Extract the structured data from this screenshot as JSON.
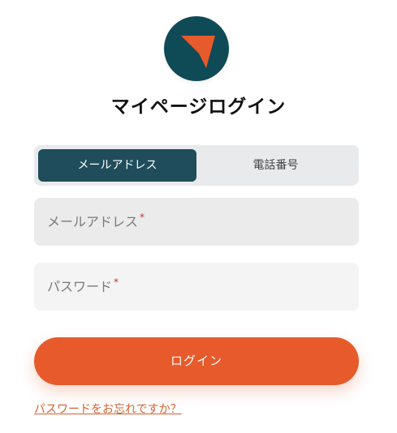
{
  "brand": {
    "logo_icon": "arrow-cursor-icon",
    "logo_bg_color": "#0f4a57",
    "logo_accent_color": "#e65a2b"
  },
  "page": {
    "title": "マイページログイン"
  },
  "tabs": {
    "items": [
      {
        "label": "メールアドレス",
        "active": true
      },
      {
        "label": "電話番号",
        "active": false
      }
    ]
  },
  "form": {
    "email_label": "メールアドレス",
    "password_label": "パスワード",
    "required_mark": "*",
    "submit_label": "ログイン",
    "forgot_label": "パスワードをお忘れですか？"
  },
  "colors": {
    "accent": "#e65a2b",
    "tab_active": "#1f4d5b",
    "required": "#c0392b"
  }
}
